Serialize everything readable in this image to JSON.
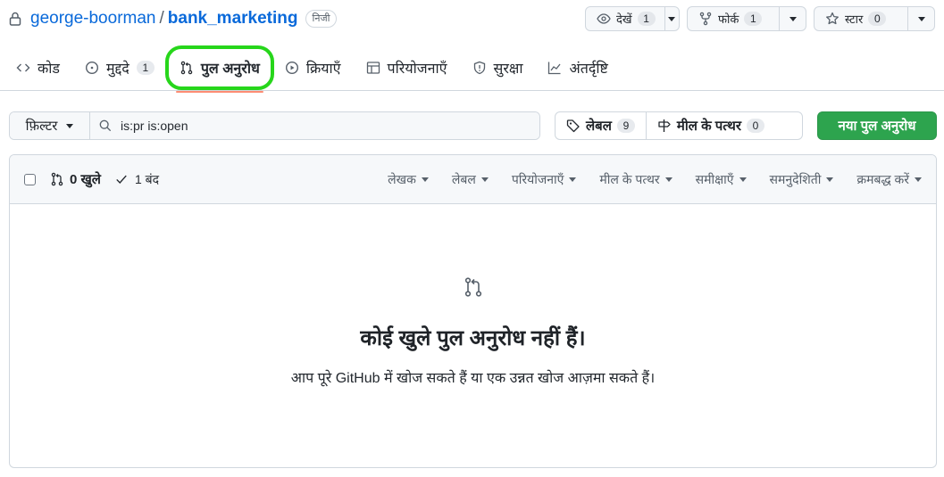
{
  "repo": {
    "owner": "george-boorman",
    "separator": "/",
    "name": "bank_marketing",
    "visibility": "निजी"
  },
  "actions": {
    "watch": {
      "label": "देखें",
      "count": "1"
    },
    "fork": {
      "label": "फोर्क",
      "count": "1"
    },
    "star": {
      "label": "स्टार",
      "count": "0"
    }
  },
  "tabs": [
    {
      "label": "कोड",
      "icon": "code-icon"
    },
    {
      "label": "मुद्ददे",
      "icon": "issue-icon",
      "count": "1"
    },
    {
      "label": "पुल अनुरोध",
      "icon": "pull-request-icon",
      "selected": true
    },
    {
      "label": "क्रियाएँ",
      "icon": "play-icon"
    },
    {
      "label": "परियोजनाएँ",
      "icon": "table-icon"
    },
    {
      "label": "सुरक्षा",
      "icon": "shield-icon"
    },
    {
      "label": "अंतर्दृष्टि",
      "icon": "graph-icon"
    }
  ],
  "highlight_color": "#27d61b",
  "subnav": {
    "filter_label": "फ़िल्टर",
    "search_value": "is:pr is:open",
    "labels_label": "लेबल",
    "labels_count": "9",
    "milestones_label": "मील के पत्थर",
    "milestones_count": "0",
    "new_pr_label": "नया पुल अनुरोध",
    "new_pr_color": "#2da44e"
  },
  "box_header": {
    "open_label": "0 खुले",
    "closed_label": "1 बंद",
    "filters": [
      "लेखक",
      "लेबल",
      "परियोजनाएँ",
      "मील के पत्थर",
      "समीक्षाएँ",
      "समनुदेशिती",
      "क्रमबद्ध करें"
    ]
  },
  "blankslate": {
    "title": "कोई खुले पुल अनुरोध नहीं हैं।",
    "description": "आप पूरे GitHub में खोज सकते हैं या एक उन्नत खोज आज़मा सकते हैं।"
  }
}
